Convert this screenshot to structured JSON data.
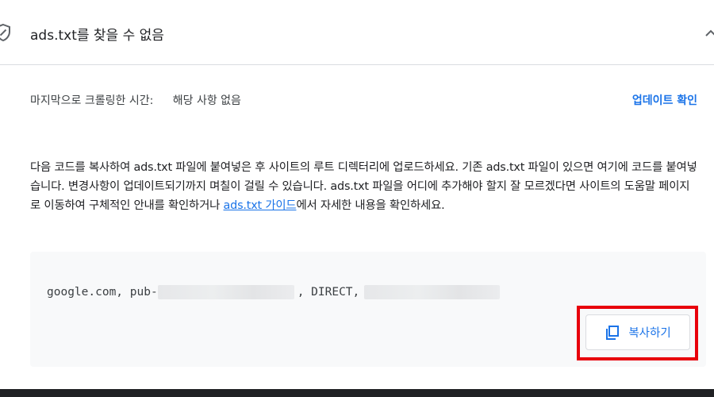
{
  "header": {
    "title": "ads.txt를 찾을 수 없음",
    "icons": {
      "status": "shield-icon",
      "collapse": "chevron-up-icon"
    }
  },
  "crawl": {
    "label": "마지막으로 크롤링한 시간:",
    "value": "해당 사항 없음",
    "update_link": "업데이트 확인"
  },
  "description": {
    "text_before": "다음 코드를 복사하여 ads.txt 파일에 붙여넣은 후 사이트의 루트 디렉터리에 업로드하세요. 기존 ads.txt 파일이 있으면 여기에 코드를 붙여넣습니다. 변경사항이 업데이트되기까지 며칠이 걸릴 수 있습니다. ads.txt 파일을 어디에 추가해야 할지 잘 모르겠다면 사이트의 도움말 페이지로 이동하여 구체적인 안내를 확인하거나 ",
    "link": "ads.txt 가이드",
    "text_after": "에서 자세한 내용을 확인하세요."
  },
  "code": {
    "part1": "google.com, pub-",
    "part2": ", DIRECT,"
  },
  "copy_button": {
    "label": "복사하기",
    "icon": "copy-icon"
  },
  "colors": {
    "accent": "#1a73e8",
    "highlight": "#e8000b"
  }
}
